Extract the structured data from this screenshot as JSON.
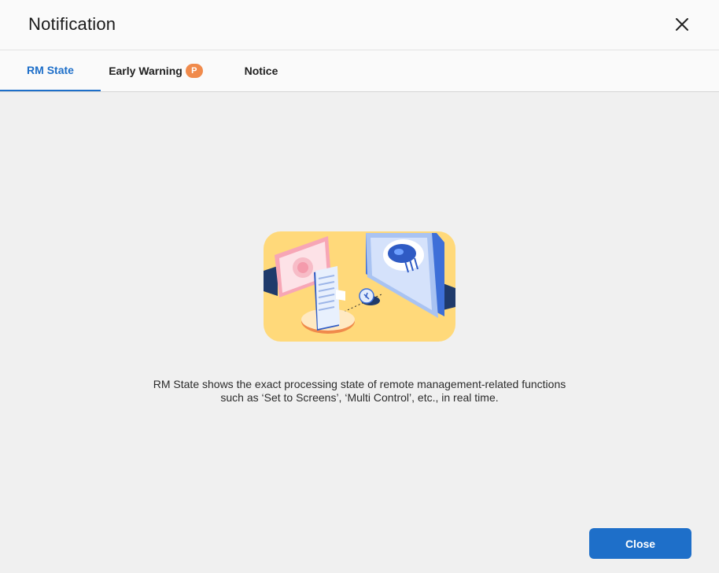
{
  "dialog": {
    "title": "Notification",
    "close_icon": "close-icon"
  },
  "tabs": [
    {
      "label": "RM State",
      "active": true
    },
    {
      "label": "Early Warning",
      "badge": "P",
      "active": false
    },
    {
      "label": "Notice",
      "active": false
    }
  ],
  "content": {
    "illustration": "remote-management-illustration",
    "description_line1": "RM State shows the exact processing state of remote management-related functions",
    "description_line2": "such as ‘Set to Screens’, ‘Multi Control’, etc., in real time."
  },
  "footer": {
    "close_label": "Close"
  },
  "colors": {
    "accent": "#1e6fc9",
    "badge": "#f08a4b",
    "illustration_bg": "#ffd97a"
  }
}
